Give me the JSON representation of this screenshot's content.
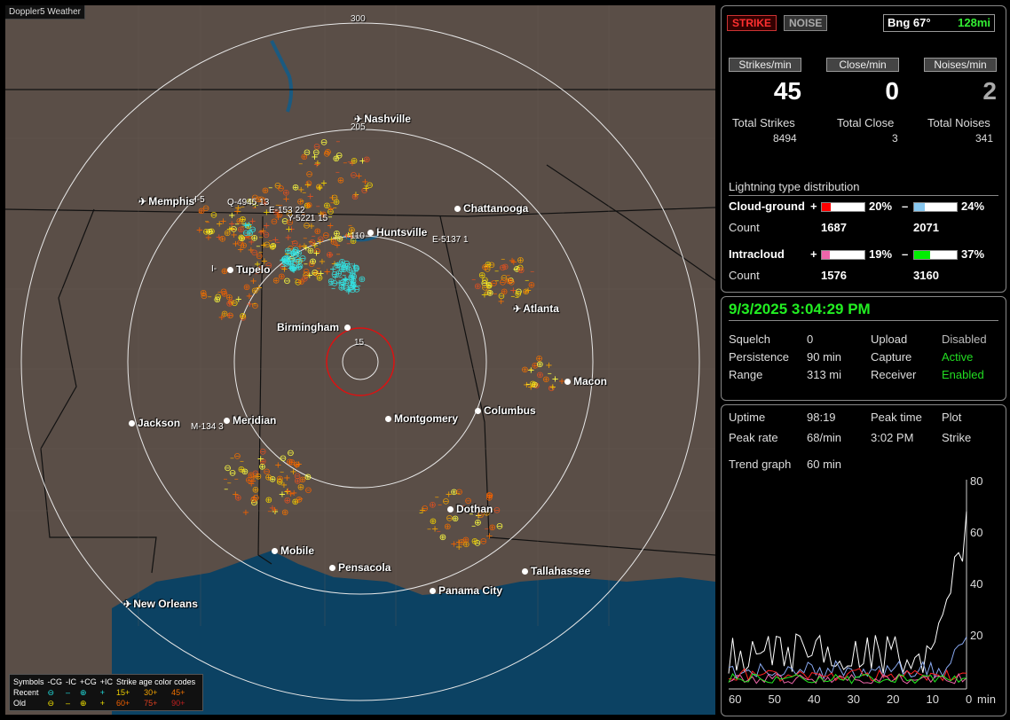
{
  "map": {
    "app_title": "Doppler5 Weather",
    "ring_labels": [
      "300",
      "205",
      "110",
      "15"
    ],
    "cities": [
      {
        "name": "Nashville",
        "type": "airport"
      },
      {
        "name": "Memphis",
        "type": "airport"
      },
      {
        "name": "Chattanooga",
        "type": "city"
      },
      {
        "name": "Huntsville",
        "type": "city"
      },
      {
        "name": "Tupelo",
        "type": "city"
      },
      {
        "name": "Atlanta",
        "type": "airport"
      },
      {
        "name": "Birmingham",
        "type": "city"
      },
      {
        "name": "Macon",
        "type": "city"
      },
      {
        "name": "Jackson",
        "type": "city"
      },
      {
        "name": "Meridian",
        "type": "city"
      },
      {
        "name": "Montgomery",
        "type": "city"
      },
      {
        "name": "Columbus",
        "type": "city"
      },
      {
        "name": "Dothan",
        "type": "city"
      },
      {
        "name": "Mobile",
        "type": "city"
      },
      {
        "name": "Pensacola",
        "type": "city"
      },
      {
        "name": "Tallahassee",
        "type": "city"
      },
      {
        "name": "Panama City",
        "type": "city"
      },
      {
        "name": "New Orleans",
        "type": "airport"
      }
    ],
    "storm_tags": [
      "Q-4945 13",
      "E-153 22",
      "Y-5221 15",
      "E-5137 1",
      "M-134 3",
      "I-5",
      "I-"
    ],
    "legend": {
      "headers": [
        "Symbols",
        "-CG",
        "-IC",
        "+CG",
        "+IC",
        "Strike age color codes"
      ],
      "recent_label": "Recent",
      "old_label": "Old",
      "recent_ages": [
        "15+",
        "30+",
        "45+"
      ],
      "old_ages": [
        "60+",
        "75+",
        "90+"
      ]
    }
  },
  "status": {
    "strike_label": "STRIKE",
    "noise_label": "NOISE",
    "bearing": "Bng 67°",
    "distance": "128mi",
    "rate_buttons": [
      "Strikes/min",
      "Close/min",
      "Noises/min"
    ],
    "strikes_per_min": "45",
    "close_per_min": "0",
    "noises_per_min": "2",
    "total_labels": [
      "Total Strikes",
      "Total Close",
      "Total Noises"
    ],
    "totals": [
      "8494",
      "3",
      "341"
    ],
    "dist_title": "Lightning type distribution",
    "cloud_ground": "Cloud-ground",
    "intracloud": "Intracloud",
    "count": "Count",
    "plus": "+",
    "minus": "–",
    "cg_pos_pct": "20%",
    "cg_neg_pct": "24%",
    "cg_pos_count": "1687",
    "cg_neg_count": "2071",
    "ic_pos_pct": "19%",
    "ic_neg_pct": "37%",
    "ic_pos_count": "1576",
    "ic_neg_count": "3160",
    "bar_fractions": {
      "cg_pos": 0.2,
      "cg_neg": 0.24,
      "ic_pos": 0.19,
      "ic_neg": 0.37
    },
    "colors": {
      "cg_pos": "#ff0000",
      "cg_neg": "#88c8f0",
      "ic_pos": "#ee66aa",
      "ic_neg": "#00ee00"
    }
  },
  "settings": {
    "datetime": "9/3/2025 3:04:29 PM",
    "rows": [
      [
        "Squelch",
        "0",
        "Upload",
        "Disabled"
      ],
      [
        "Persistence",
        "90 min",
        "Capture",
        "Active"
      ],
      [
        "Range",
        "313 mi",
        "Receiver",
        "Enabled"
      ]
    ]
  },
  "trend": {
    "uptime_label": "Uptime",
    "uptime": "98:19",
    "peak_time_label": "Peak time",
    "plot_label": "Plot",
    "peak_rate_label": "Peak rate",
    "peak_rate": "68/min",
    "peak_time": "3:02 PM",
    "plot": "Strike",
    "trend_label": "Trend graph",
    "trend_value": "60 min",
    "x_ticks": [
      "60",
      "50",
      "40",
      "30",
      "20",
      "10",
      "0"
    ],
    "x_unit": "min",
    "y_ticks": [
      "80",
      "60",
      "40",
      "20"
    ]
  }
}
